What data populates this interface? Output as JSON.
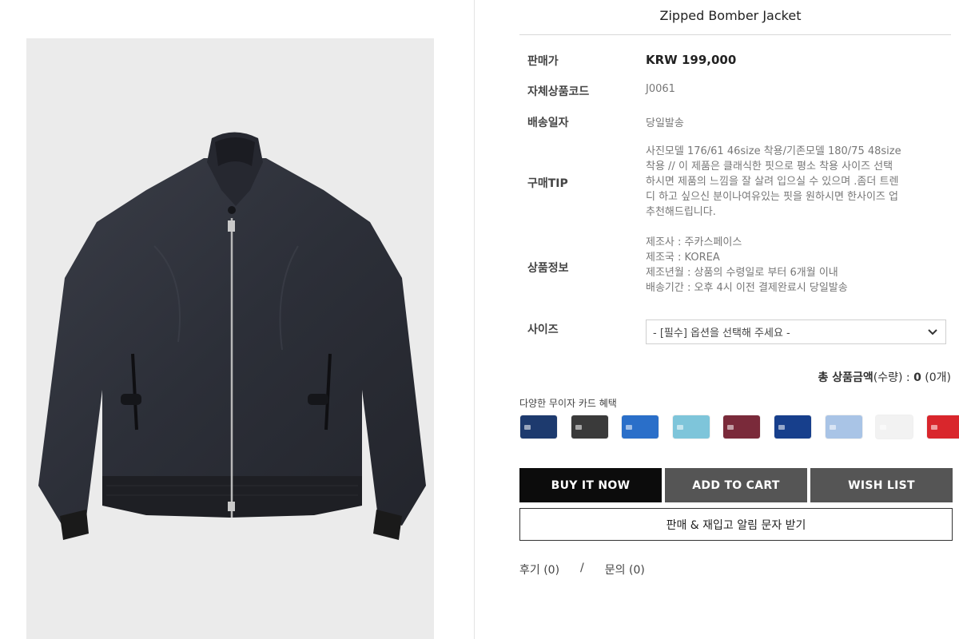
{
  "product": {
    "title": "Zipped Bomber Jacket"
  },
  "info": {
    "price_label": "판매가",
    "price_value": "KRW 199,000",
    "code_label": "자체상품코드",
    "code_value": "J0061",
    "shipping_label": "배송일자",
    "shipping_value": "당일발송",
    "tip_label": "구매TIP",
    "tip_lines": [
      "사진모델 176/61 46size 착용/기존모델 180/75 48size",
      "착용 // 이 제품은 클래식한 핏으로 평소 착용 사이즈 선택",
      "하시면 제품의 느낌을 잘 살려 입으실 수 있으며 .좀더 트렌",
      "디 하고 싶으신 분이나여유있는 핏을 원하시면 한사이즈 업",
      "추천해드립니다."
    ],
    "detail_label": "상품정보",
    "detail_lines": [
      "제조사 : 주카스페이스",
      "제조국 : KOREA",
      "제조년월 : 상품의 수령일로 부터 6개월 이내",
      "배송기간 : 오후 4시 이전 결제완료시 당일발송"
    ],
    "size_label": "사이즈",
    "size_select_value": "- [필수] 옵션을 선택해 주세요 -"
  },
  "total": {
    "label": "총 상품금액",
    "qty_label": "(수량) : ",
    "amount": "0",
    "count": " (0개)"
  },
  "cards": {
    "title": "다양한 무이자 카드 혜택",
    "colors": [
      "#1d3a6e",
      "#3a3a3a",
      "#2a6fc9",
      "#7ec5da",
      "#7a2a3a",
      "#173f8c",
      "#a9c4e6",
      "#f2f2f2",
      "#d9262c"
    ]
  },
  "buttons": {
    "buy": "BUY IT NOW",
    "cart": "ADD TO CART",
    "wish": "WISH LIST",
    "sms": "판매 & 재입고 알림 문자 받기"
  },
  "links": {
    "review": "후기 (0)",
    "separator": "/",
    "qna": "문의 (0)"
  }
}
